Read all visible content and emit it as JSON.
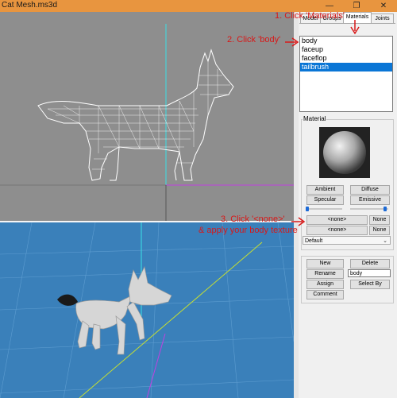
{
  "window": {
    "title": "Cat Mesh.ms3d",
    "minimize_glyph": "—",
    "maximize_glyph": "❐",
    "close_glyph": "✕"
  },
  "tabs": [
    {
      "label": "Model",
      "active": false
    },
    {
      "label": "Groups",
      "active": false
    },
    {
      "label": "Materials",
      "active": true
    },
    {
      "label": "Joints",
      "active": false
    }
  ],
  "materials_list": [
    {
      "label": "body",
      "selected": false
    },
    {
      "label": "faceup",
      "selected": false
    },
    {
      "label": "faceflop",
      "selected": false
    },
    {
      "label": "tailbrush",
      "selected": true
    }
  ],
  "material_group": {
    "title": "Material",
    "buttons": {
      "ambient": "Ambient",
      "diffuse": "Diffuse",
      "specular": "Specular",
      "emissive": "Emissive"
    },
    "texture_row": {
      "texture": "<none>",
      "clear": "None"
    },
    "alpha_row": {
      "texture": "<none>",
      "clear": "None"
    },
    "mode_select": "Default"
  },
  "actions": {
    "new": "New",
    "delete": "Delete",
    "rename": "Rename",
    "name_value": "body",
    "assign": "Assign",
    "select_by": "Select By",
    "comment": "Comment"
  },
  "annotations": {
    "step1": "1. Click 'Materials'",
    "step2": "2. Click 'body'",
    "step3_line1": "3. Click '<none>'",
    "step3_line2": "& apply your body texture"
  },
  "colors": {
    "titlebar": "#e8953f",
    "viewport_top_bg": "#8e8e8e",
    "viewport_bottom_bg": "#3a80ba",
    "selection": "#0a76d6",
    "annotation": "#d81818"
  }
}
